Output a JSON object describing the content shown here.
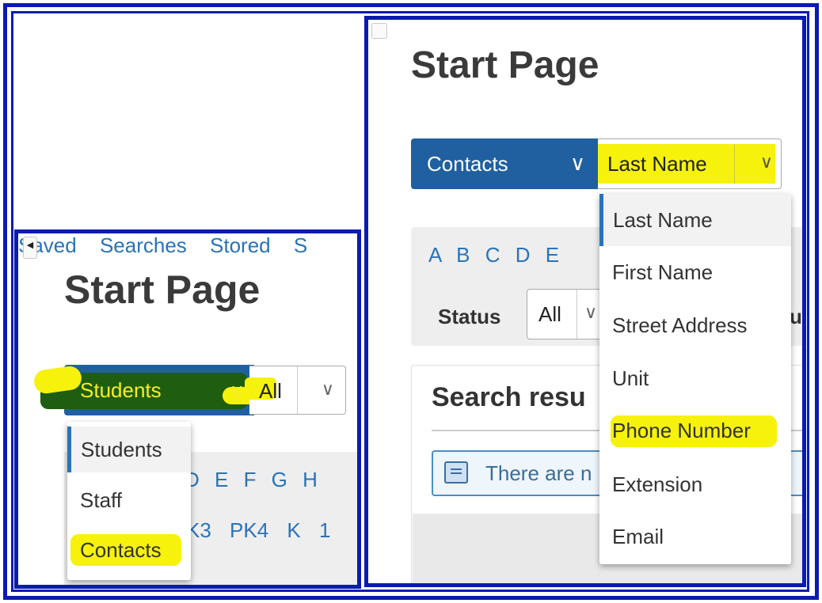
{
  "left": {
    "title": "Start Page",
    "type_button": "Students",
    "type_select_value": "All",
    "dropdown": [
      "Students",
      "Staff",
      "Contacts"
    ],
    "alphabet": "D E F G H",
    "grades": "K3 PK4 K 1",
    "searches": "Saved Searches Stored S"
  },
  "right": {
    "title": "Start Page",
    "type_button": "Contacts",
    "field_select_value": "Last Name",
    "dropdown": [
      "Last Name",
      "First Name",
      "Street Address",
      "Unit",
      "Phone Number",
      "Extension",
      "Email"
    ],
    "alphabet": "A B C D E",
    "status_label": "Status",
    "status_value": "All",
    "status_cut": "u",
    "results_title": "Search resu",
    "info_text": "There are n"
  },
  "colors": {
    "frame": "#0a1bb0",
    "primary_button": "#2060a0",
    "highlighter": "#f6f20c",
    "link": "#2a73b8"
  }
}
